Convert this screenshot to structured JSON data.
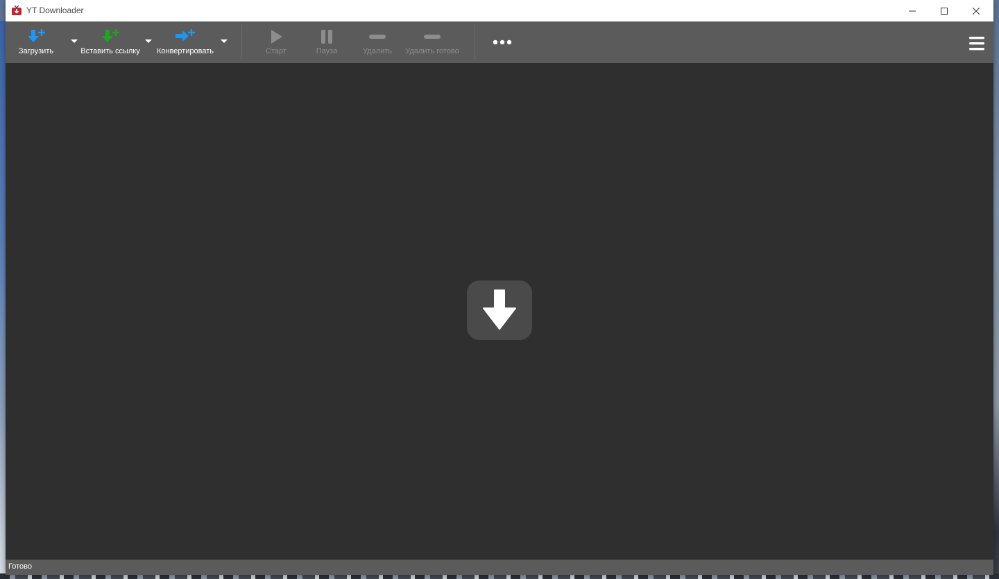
{
  "window": {
    "title": "YT Downloader"
  },
  "toolbar": {
    "download_label": "Загрузить",
    "paste_link_label": "Вставить ссылку",
    "convert_label": "Конвертировать",
    "start_label": "Старт",
    "pause_label": "Пауза",
    "delete_label": "Удалить",
    "delete_done_label": "Удалить готово"
  },
  "icons": {
    "download": "download-plus-icon",
    "paste_link": "paste-link-plus-icon",
    "convert": "convert-plus-icon",
    "start": "play-icon",
    "pause": "pause-icon",
    "delete": "minus-icon",
    "delete_done": "minus-icon",
    "more": "more-dots-icon",
    "menu": "hamburger-icon",
    "drop": "download-arrow-icon"
  },
  "colors": {
    "accent_blue": "#1f96f3",
    "accent_green": "#1fa51f",
    "toolbar_bg": "#5b5b5b",
    "content_bg": "#2f2f2f"
  },
  "status": {
    "text": "Готово"
  }
}
